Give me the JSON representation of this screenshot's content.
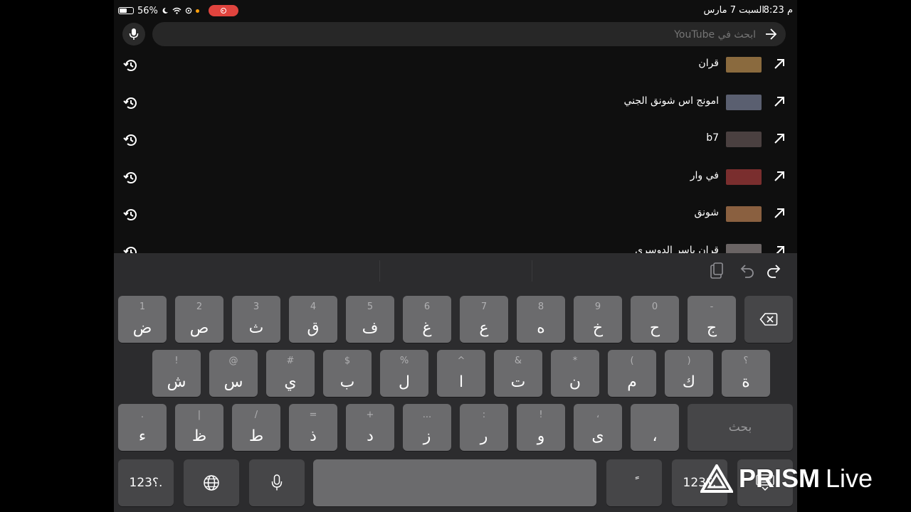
{
  "status_bar": {
    "time": "8:23 م",
    "date": "السبت 7 مارس",
    "battery_percent": "56%",
    "battery_level": 0.56
  },
  "search": {
    "placeholder": "ابحث في YouTube",
    "value": ""
  },
  "suggestions": [
    {
      "text": "قران",
      "thumb_color": "#8a6a3e"
    },
    {
      "text": "امونج اس شونق الجني",
      "thumb_color": "#5a5f70"
    },
    {
      "text": "b7",
      "thumb_color": "#4a4040"
    },
    {
      "text": "في وار",
      "thumb_color": "#7a2e2e"
    },
    {
      "text": "شونق",
      "thumb_color": "#8a6040"
    },
    {
      "text": "قران ياسر الدوسري",
      "thumb_color": "#6a6464"
    }
  ],
  "keyboard": {
    "row1": [
      {
        "alt": "1",
        "main": "ض"
      },
      {
        "alt": "2",
        "main": "ص"
      },
      {
        "alt": "3",
        "main": "ث"
      },
      {
        "alt": "4",
        "main": "ق"
      },
      {
        "alt": "5",
        "main": "ف"
      },
      {
        "alt": "6",
        "main": "غ"
      },
      {
        "alt": "7",
        "main": "ع"
      },
      {
        "alt": "8",
        "main": "ه"
      },
      {
        "alt": "9",
        "main": "خ"
      },
      {
        "alt": "0",
        "main": "ح"
      },
      {
        "alt": "-",
        "main": "ج"
      }
    ],
    "row2": [
      {
        "alt": "!",
        "main": "ش"
      },
      {
        "alt": "@",
        "main": "س"
      },
      {
        "alt": "#",
        "main": "ي"
      },
      {
        "alt": "$",
        "main": "ب"
      },
      {
        "alt": "%",
        "main": "ل"
      },
      {
        "alt": "^",
        "main": "ا"
      },
      {
        "alt": "&",
        "main": "ت"
      },
      {
        "alt": "*",
        "main": "ن"
      },
      {
        "alt": "(",
        "main": "م"
      },
      {
        "alt": ")",
        "main": "ك"
      },
      {
        "alt": "؟",
        "main": "ة"
      }
    ],
    "row3": [
      {
        "alt": ".",
        "main": "ء"
      },
      {
        "alt": "|",
        "main": "ظ"
      },
      {
        "alt": "/",
        "main": "ط"
      },
      {
        "alt": "=",
        "main": "ذ"
      },
      {
        "alt": "+",
        "main": "د"
      },
      {
        "alt": "...",
        "main": "ز"
      },
      {
        "alt": ":",
        "main": "ر"
      },
      {
        "alt": "!",
        "main": "و"
      },
      {
        "alt": "،",
        "main": "ى"
      },
      {
        "alt": "",
        "main": "،"
      }
    ],
    "search_key": "بحث",
    "numbers_left": "123؟.",
    "numbers_right": "123؟.",
    "diacritic": "ً"
  },
  "watermark": {
    "brand": "PRISM",
    "suffix": "Live"
  }
}
